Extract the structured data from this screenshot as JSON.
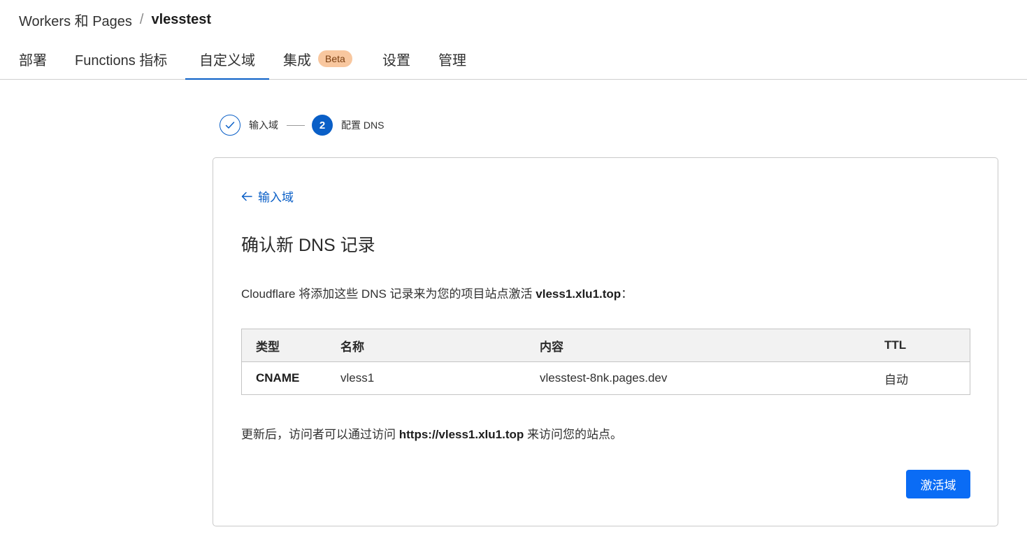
{
  "breadcrumb": {
    "parent": "Workers 和 Pages",
    "separator": "/",
    "current": "vlesstest"
  },
  "tabs": [
    {
      "label": "部署"
    },
    {
      "label": "Functions 指标"
    },
    {
      "label": "自定义域"
    },
    {
      "label": "集成",
      "badge": "Beta"
    },
    {
      "label": "设置"
    },
    {
      "label": "管理"
    }
  ],
  "active_tab": "自定义域",
  "stepper": {
    "step1": {
      "label": "输入域",
      "icon": "check-icon"
    },
    "step2": {
      "number": "2",
      "label": "配置 DNS"
    }
  },
  "card": {
    "back_link": "输入域",
    "title": "确认新 DNS 记录",
    "description_prefix": "Cloudflare 将添加这些 DNS 记录来为您的项目站点激活 ",
    "description_domain": "vless1.xlu1.top",
    "description_suffix": "：",
    "table": {
      "headers": [
        "类型",
        "名称",
        "内容",
        "TTL"
      ],
      "rows": [
        [
          "CNAME",
          "vless1",
          "vlesstest-8nk.pages.dev",
          "自动"
        ]
      ]
    },
    "note_prefix": "更新后，访问者可以通过访问 ",
    "note_url": "https://vless1.xlu1.top",
    "note_suffix": " 来访问您的站点。",
    "button_label": "激活域"
  },
  "colors": {
    "accent": "#0a5fc7",
    "button": "#0a6cf5",
    "badge_bg": "#f8c79f"
  }
}
